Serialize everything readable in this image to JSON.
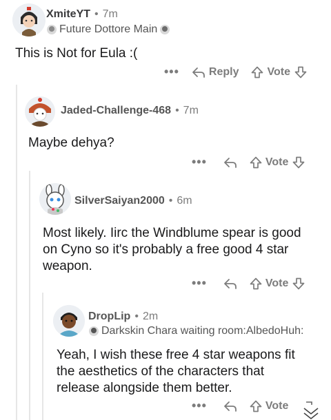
{
  "comments": [
    {
      "username": "XmiteYT",
      "time": "7m",
      "flair": "Future Dottore Main",
      "body": "This is Not for Eula :(",
      "reply_label": "Reply",
      "vote_label": "Vote"
    },
    {
      "username": "Jaded-Challenge-468",
      "time": "7m",
      "body": "Maybe dehya?",
      "vote_label": "Vote"
    },
    {
      "username": "SilverSaiyan2000",
      "time": "6m",
      "body_lines": [
        "Most likely. Iirc the Windblume spear is good",
        "on Cyno so it's probably a free good 4 star",
        "weapon."
      ],
      "vote_label": "Vote"
    },
    {
      "username": "DropLip",
      "time": "2m",
      "flair": "Darkskin Chara waiting room:AlbedoHuh:",
      "body_lines": [
        "Yeah, I wish these free 4 star weapons fit",
        "the aesthetics of the characters that",
        "release alongside them better."
      ],
      "vote_label": "Vote"
    }
  ],
  "separator": "•",
  "more_dots": "•••"
}
